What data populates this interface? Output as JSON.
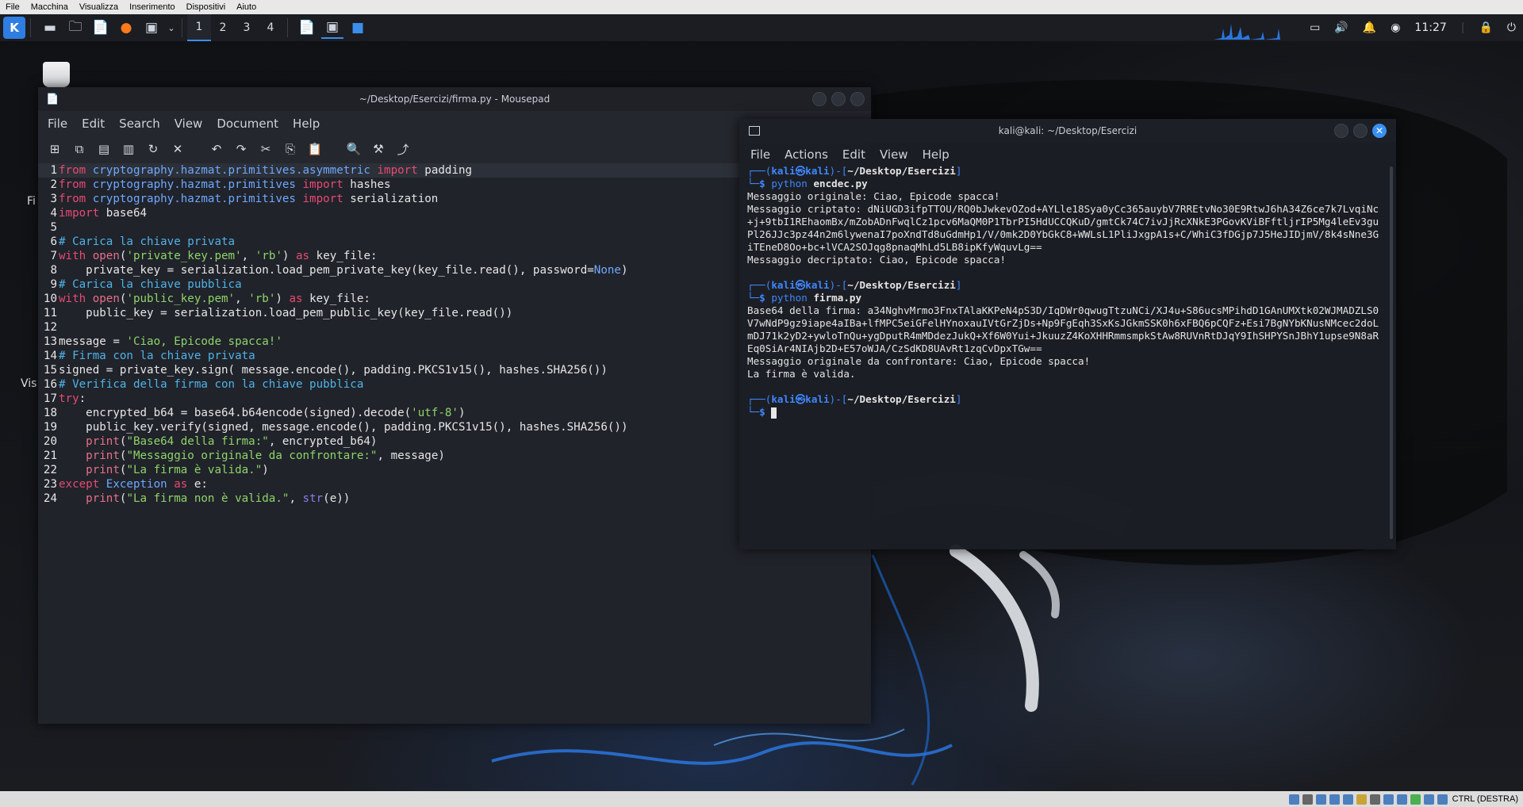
{
  "vbox": {
    "menu": [
      "File",
      "Macchina",
      "Visualizza",
      "Inserimento",
      "Dispositivi",
      "Aiuto"
    ],
    "host_key": "CTRL (DESTRA)"
  },
  "panel": {
    "workspaces": [
      "1",
      "2",
      "3",
      "4"
    ],
    "active_workspace": "1",
    "clock": "11:27"
  },
  "desktop": {
    "icon_labels": [
      "Fi",
      "Vis"
    ]
  },
  "mousepad": {
    "title": "~/Desktop/Esercizi/firma.py - Mousepad",
    "menu": [
      "File",
      "Edit",
      "Search",
      "View",
      "Document",
      "Help"
    ]
  },
  "terminal": {
    "title": "kali@kali: ~/Desktop/Esercizi",
    "menu": [
      "File",
      "Actions",
      "Edit",
      "View",
      "Help"
    ],
    "user": "kali",
    "host": "kali",
    "cwd": "~/Desktop/Esercizi",
    "cmd1": "encdec.py",
    "cmd2": "firma.py",
    "python": "python",
    "out1_orig": "Messaggio originale: Ciao, Epicode spacca!",
    "out1_enc": "Messaggio criptato: dNiUGD3ifpTTOU/RQ0bJwkevOZod+AYLle18Sya0yCc365auybV7RREtvNo30E9RtwJ6hA34Z6ce7k7LvqiNc+j+9tbI1REhaomBx/mZobADnFwqlCz1pcv6MaQM0P1TbrPI5HdUCCQKuD/gmtCk74C7ivJjRcXNkE3PGovKViBFftljrIP5Mg4leEv3guPl26JJc3pz44n2m6lywenaI7poXndTd8uGdmHp1/V/0mk2D0YbGkC8+WWLsL1PliJxgpA1s+C/WhiC3fDGjp7J5HeJIDjmV/8k4sNne3GiTEneD8Oo+bc+lVCA2SOJqg8pnaqMhLd5LB8ipKfyWquvLg==",
    "out1_dec": "Messaggio decriptato: Ciao, Epicode spacca!",
    "out2_b64": "Base64 della firma: a34NghvMrmo3FnxTAlaKKPeN4pS3D/IqDWr0qwugTtzuNCi/XJ4u+S86ucsMPihdD1GAnUMXtk02WJMADZLS0V7wNdP9gz9iape4aIBa+lfMPC5eiGFelHYnoxauIVtGrZjDs+Np9FgEqh3SxKsJGkmSSK0h6xFBQ6pCQFz+Esi7BgNYbKNusNMcec2doLmDJ71k2yD2+ywloTnQu+ygDputR4mMDdezJukQ+Xf6W0Yui+JkuuzZ4KoXHHRmmsmpkStAw8RUVnRtDJqY9IhSHPYSnJBhY1upse9N8aREq0SiAr4NIAjb2D+E57oWJA/CzSdKD8UAvRt1zqCvDpxTGw==",
    "out2_orig": "Messaggio originale da confrontare: Ciao, Epicode spacca!",
    "out2_valid": "La firma è valida."
  },
  "code_lines": [
    [
      "from",
      " ",
      "cryptography.hazmat.primitives.asymmetric",
      " ",
      "import",
      " padding"
    ],
    [
      "from",
      " ",
      "cryptography.hazmat.primitives",
      " ",
      "import",
      " hashes"
    ],
    [
      "from",
      " ",
      "cryptography.hazmat.primitives",
      " ",
      "import",
      " serialization"
    ],
    [
      "import",
      " base64"
    ],
    [
      ""
    ],
    [
      "# Carica la chiave privata"
    ],
    [
      "with",
      " ",
      "open",
      "(",
      "'private_key.pem'",
      ", ",
      "'rb'",
      ") ",
      "as",
      " key_file:"
    ],
    [
      "    private_key = serialization.load_pem_private_key(key_file.read(), password=",
      "None",
      ")"
    ],
    [
      "# Carica la chiave pubblica"
    ],
    [
      "with",
      " ",
      "open",
      "(",
      "'public_key.pem'",
      ", ",
      "'rb'",
      ") ",
      "as",
      " key_file:"
    ],
    [
      "    public_key = serialization.load_pem_public_key(key_file.read())"
    ],
    [
      ""
    ],
    [
      "message = ",
      "'Ciao, Epicode spacca!'"
    ],
    [
      "# Firma con la chiave privata"
    ],
    [
      "signed = private_key.sign( message.encode(), padding.PKCS1v15(), hashes.SHA256())"
    ],
    [
      "# Verifica della firma con la chiave pubblica"
    ],
    [
      "try",
      ":"
    ],
    [
      "    encrypted_b64 = base64.b64encode(signed).decode(",
      "'utf-8'",
      ")"
    ],
    [
      "    public_key.verify(signed, message.encode(), padding.PKCS1v15(), hashes.SHA256())"
    ],
    [
      "    ",
      "print",
      "(",
      "\"Base64 della firma:\"",
      ", encrypted_b64)"
    ],
    [
      "    ",
      "print",
      "(",
      "\"Messaggio originale da confrontare:\"",
      ", message)"
    ],
    [
      "    ",
      "print",
      "(",
      "\"La firma è valida.\"",
      ")"
    ],
    [
      "except",
      " ",
      "Exception",
      " ",
      "as",
      " e:"
    ],
    [
      "    ",
      "print",
      "(",
      "\"La firma non è valida.\"",
      ", ",
      "str",
      "(e))"
    ]
  ],
  "code_classes": [
    [
      "kw",
      "",
      "mod",
      "",
      "kw",
      ""
    ],
    [
      "kw",
      "",
      "mod",
      "",
      "kw",
      ""
    ],
    [
      "kw",
      "",
      "mod",
      "",
      "kw",
      ""
    ],
    [
      "kw",
      ""
    ],
    [
      ""
    ],
    [
      "com"
    ],
    [
      "kw",
      "",
      "pr",
      "",
      "str",
      "",
      "str",
      "",
      "kw",
      ""
    ],
    [
      "",
      "mod",
      ""
    ],
    [
      "com"
    ],
    [
      "kw",
      "",
      "pr",
      "",
      "str",
      "",
      "str",
      "",
      "kw",
      ""
    ],
    [
      ""
    ],
    [
      ""
    ],
    [
      "",
      "str"
    ],
    [
      "com"
    ],
    [
      ""
    ],
    [
      "com"
    ],
    [
      "kw",
      ""
    ],
    [
      "",
      "str",
      ""
    ],
    [
      ""
    ],
    [
      "",
      "pr",
      "",
      "str",
      ""
    ],
    [
      "",
      "pr",
      "",
      "str",
      ""
    ],
    [
      "",
      "pr",
      "",
      "str",
      ""
    ],
    [
      "kw",
      "",
      "mod",
      "",
      "kw",
      ""
    ],
    [
      "",
      "pr",
      "",
      "str",
      "",
      "bi",
      ""
    ]
  ]
}
